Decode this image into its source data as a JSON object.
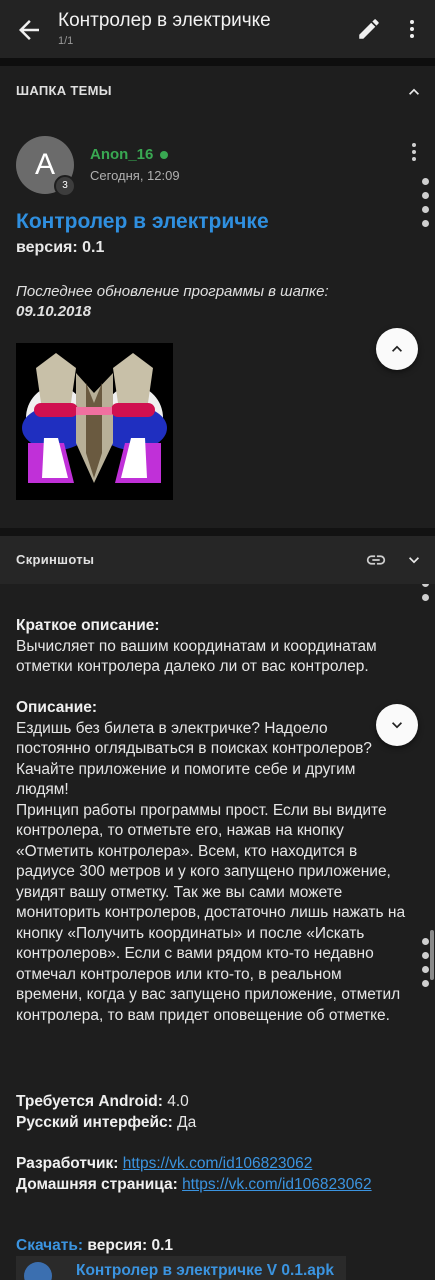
{
  "topbar": {
    "title": "Контролер в электричке",
    "pages": "1/1",
    "back_icon": "arrow-back-icon",
    "edit_icon": "pencil-icon",
    "menu_icon": "more-vert-icon"
  },
  "header_section": {
    "label": "ШАПКА ТЕМЫ"
  },
  "author": {
    "initial": "A",
    "badge": "3",
    "username": "Anon_16",
    "time": "Сегодня, 12:09"
  },
  "post": {
    "title": "Контролер в электричке",
    "version": "версия: 0.1",
    "updated_text": "Последнее обновление программы в шапке:",
    "updated_date": "09.10.2018"
  },
  "screenshots_section": {
    "label": "Скриншоты"
  },
  "content": {
    "short_desc_label": "Краткое описание:",
    "short_desc": "Вычисляет по вашим координатам и координатам отметки контролера далеко ли от вас контролер.",
    "desc_label": "Описание:",
    "desc_p1": "Ездишь без билета в электричке? Надоело постоянно оглядываться в поисках контролеров? Качайте приложение и помогите себе и другим людям!",
    "desc_p2": "Принцип работы программы прост. Если вы видите контролера, то отметьте его, нажав на кнопку «Отметить контролера». Всем, кто находится в радиусе 300 метров и у кого запущено приложение, увидят вашу отметку. Так же вы сами можете мониторить контролеров, достаточно лишь нажать на кнопку «Получить координаты» и после «Искать контролеров». Если с вами рядом кто-то недавно отмечал контролеров или кто-то, в реальном времени, когда у вас запущено приложение, отметил контролера, то вам придет оповещение об отметке.",
    "android_label": "Требуется Android:",
    "android_value": "4.0",
    "russian_label": "Русский интерфейс:",
    "russian_value": "Да",
    "dev_label": "Разработчик:",
    "dev_link": "https://vk.com/id106823062",
    "home_label": "Домашняя страница:",
    "home_link": "https://vk.com/id106823062",
    "download_label": "Скачать:",
    "download_version": "версия: 0.1",
    "file_name": "Контролер в электричке V 0.1.apk"
  },
  "colors": {
    "background": "#1e1e1e",
    "accent_blue": "#2f8fdf",
    "online_green": "#39a852"
  }
}
